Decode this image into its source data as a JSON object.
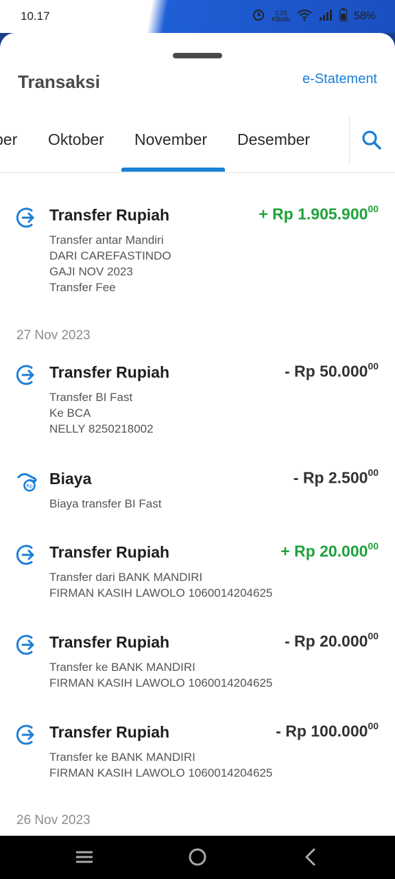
{
  "status": {
    "time": "10.17",
    "net_speed_value": "0.23",
    "net_speed_unit": "KB/dtk",
    "battery": "58%",
    "icons": [
      "alarm-icon",
      "wifi-icon",
      "signal-icon",
      "battery-icon"
    ]
  },
  "header": {
    "title": "Transaksi",
    "estatement": "e-Statement"
  },
  "tabs": [
    {
      "label": "ber"
    },
    {
      "label": "Oktober"
    },
    {
      "label": "November",
      "active": true
    },
    {
      "label": "Desember"
    }
  ],
  "colors": {
    "accent": "#1a7fd6",
    "positive": "#1ea33a",
    "negative": "#333333"
  },
  "dates": [
    {
      "label": "27 Nov 2023"
    },
    {
      "label": "26 Nov 2023"
    }
  ],
  "transactions": [
    {
      "icon": "transfer-icon",
      "title": "Transfer Rupiah",
      "amount_main": "+ Rp 1.905.900",
      "amount_cents": "00",
      "direction": "in",
      "lines": [
        "Transfer antar Mandiri",
        "DARI CAREFASTINDO",
        "GAJI NOV 2023",
        "Transfer Fee"
      ]
    },
    {
      "icon": "transfer-icon",
      "title": "Transfer Rupiah",
      "amount_main": "- Rp 50.000",
      "amount_cents": "00",
      "direction": "out",
      "lines": [
        "Transfer BI Fast",
        "Ke BCA",
        "NELLY 8250218002"
      ]
    },
    {
      "icon": "fee-icon",
      "title": "Biaya",
      "amount_main": "- Rp 2.500",
      "amount_cents": "00",
      "direction": "out",
      "lines": [
        "Biaya transfer BI Fast"
      ]
    },
    {
      "icon": "transfer-icon",
      "title": "Transfer Rupiah",
      "amount_main": "+ Rp 20.000",
      "amount_cents": "00",
      "direction": "in",
      "lines": [
        "Transfer dari BANK MANDIRI",
        "FIRMAN KASIH LAWOLO 1060014204625"
      ]
    },
    {
      "icon": "transfer-icon",
      "title": "Transfer Rupiah",
      "amount_main": "- Rp 20.000",
      "amount_cents": "00",
      "direction": "out",
      "lines": [
        "Transfer ke BANK MANDIRI",
        "FIRMAN KASIH LAWOLO 1060014204625"
      ]
    },
    {
      "icon": "transfer-icon",
      "title": "Transfer Rupiah",
      "amount_main": "- Rp 100.000",
      "amount_cents": "00",
      "direction": "out",
      "lines": [
        "Transfer ke BANK MANDIRI",
        "FIRMAN KASIH LAWOLO 1060014204625"
      ]
    }
  ],
  "navbar": {
    "icons": [
      "recent-apps-icon",
      "home-icon",
      "back-icon"
    ]
  }
}
